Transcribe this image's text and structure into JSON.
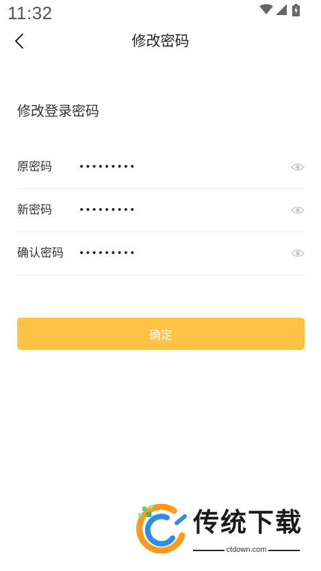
{
  "status_bar": {
    "time": "11:32",
    "icons": [
      "wifi-icon",
      "signal-icon",
      "battery-charging-icon"
    ]
  },
  "nav": {
    "title": "修改密码",
    "back_icon": "chevron-left-icon"
  },
  "section_title": "修改登录密码",
  "form": {
    "fields": [
      {
        "label": "原密码",
        "value": "123456789",
        "type": "password",
        "toggle_icon": "eye-icon"
      },
      {
        "label": "新密码",
        "value": "123456789",
        "type": "password",
        "toggle_icon": "eye-icon"
      },
      {
        "label": "确认密码",
        "value": "123456789",
        "type": "password",
        "toggle_icon": "eye-icon"
      }
    ]
  },
  "confirm_button": {
    "label": "确定"
  },
  "watermark": {
    "brand": "传统下载",
    "url": "ctdown.com"
  },
  "colors": {
    "accent": "#ffc247",
    "divider": "#eeeeee",
    "icon_gray": "#c8c8c8"
  }
}
